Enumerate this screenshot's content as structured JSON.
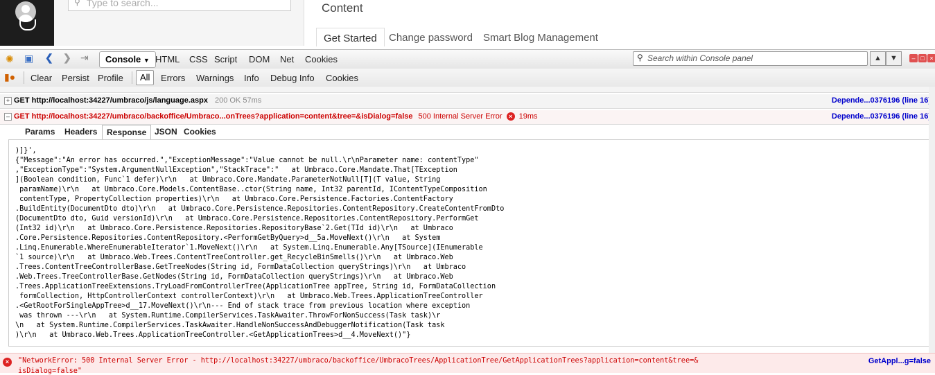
{
  "app": {
    "search_placeholder": "Type to search...",
    "content_title": "Content",
    "tabs": [
      "Get Started",
      "Change password",
      "Smart Blog Management"
    ]
  },
  "firebug": {
    "panels": [
      "Console",
      "HTML",
      "CSS",
      "Script",
      "DOM",
      "Net",
      "Cookies"
    ],
    "search_placeholder": "Search within Console panel",
    "console_buttons": [
      "Clear",
      "Persist",
      "Profile"
    ],
    "filters": [
      "All",
      "Errors",
      "Warnings",
      "Info",
      "Debug Info",
      "Cookies"
    ]
  },
  "requests": [
    {
      "method_url": "GET http://localhost:34227/umbraco/js/language.aspx",
      "status": "200 OK 57ms",
      "source": "Depende...0376196 (line 16)"
    },
    {
      "method_url": "GET http://localhost:34227/umbraco/backoffice/Umbraco...onTrees?application=content&tree=&isDialog=false",
      "status": "500 Internal Server Error",
      "time": "19ms",
      "source": "Depende...0376196 (line 16)"
    }
  ],
  "request_tabs": [
    "Params",
    "Headers",
    "Response",
    "JSON",
    "Cookies"
  ],
  "response_lines": [
    ")]}',",
    "{\"Message\":\"An error has occurred.\",\"ExceptionMessage\":\"Value cannot be null.\\r\\nParameter name: contentType\"",
    ",\"ExceptionType\":\"System.ArgumentNullException\",\"StackTrace\":\"   at Umbraco.Core.Mandate.That[TException",
    "](Boolean condition, Func`1 defer)\\r\\n   at Umbraco.Core.Mandate.ParameterNotNull[T](T value, String",
    " paramName)\\r\\n   at Umbraco.Core.Models.ContentBase..ctor(String name, Int32 parentId, IContentTypeComposition",
    " contentType, PropertyCollection properties)\\r\\n   at Umbraco.Core.Persistence.Factories.ContentFactory",
    ".BuildEntity(DocumentDto dto)\\r\\n   at Umbraco.Core.Persistence.Repositories.ContentRepository.CreateContentFromDto",
    "(DocumentDto dto, Guid versionId)\\r\\n   at Umbraco.Core.Persistence.Repositories.ContentRepository.PerformGet",
    "(Int32 id)\\r\\n   at Umbraco.Core.Persistence.Repositories.RepositoryBase`2.Get(TId id)\\r\\n   at Umbraco",
    ".Core.Persistence.Repositories.ContentRepository.<PerformGetByQuery>d__5a.MoveNext()\\r\\n   at System",
    ".Linq.Enumerable.WhereEnumerableIterator`1.MoveNext()\\r\\n   at System.Linq.Enumerable.Any[TSource](IEnumerable",
    "`1 source)\\r\\n   at Umbraco.Web.Trees.ContentTreeController.get_RecycleBinSmells()\\r\\n   at Umbraco.Web",
    ".Trees.ContentTreeControllerBase.GetTreeNodes(String id, FormDataCollection queryStrings)\\r\\n   at Umbraco",
    ".Web.Trees.TreeControllerBase.GetNodes(String id, FormDataCollection queryStrings)\\r\\n   at Umbraco.Web",
    ".Trees.ApplicationTreeExtensions.TryLoadFromControllerTree(ApplicationTree appTree, String id, FormDataCollection",
    " formCollection, HttpControllerContext controllerContext)\\r\\n   at Umbraco.Web.Trees.ApplicationTreeController",
    ".<GetRootForSingleAppTree>d__17.MoveNext()\\r\\n--- End of stack trace from previous location where exception",
    " was thrown ---\\r\\n   at System.Runtime.CompilerServices.TaskAwaiter.ThrowForNonSuccess(Task task)\\r",
    "\\n   at System.Runtime.CompilerServices.TaskAwaiter.HandleNonSuccessAndDebuggerNotification(Task task",
    ")\\r\\n   at Umbraco.Web.Trees.ApplicationTreeController.<GetApplicationTrees>d__4.MoveNext()\"}"
  ],
  "bottom_error": {
    "line1": "\"NetworkError: 500 Internal Server Error - http://localhost:34227/umbraco/backoffice/UmbracoTrees/ApplicationTree/GetApplicationTrees?application=content&tree=&",
    "line2": "isDialog=false\"",
    "source": "GetAppl...g=false"
  },
  "colors": {
    "error_red": "#cc0000",
    "link_blue": "#0000cc",
    "sidebar_dark": "#1d1d1d"
  }
}
